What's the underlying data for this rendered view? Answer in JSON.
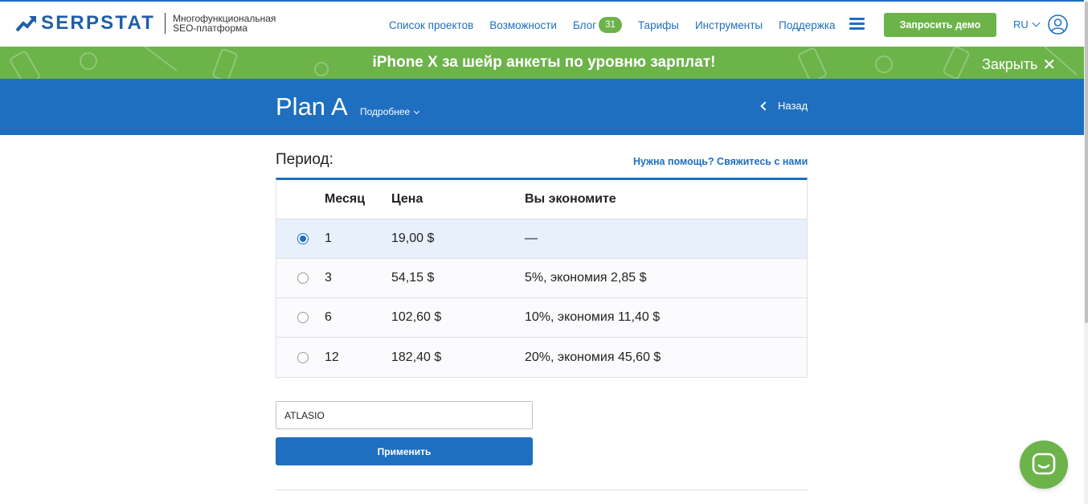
{
  "header": {
    "brand": "SERPSTAT",
    "tagline": "Многофункциональная SEO-платформа",
    "nav": [
      {
        "label": "Список проектов"
      },
      {
        "label": "Возможности"
      },
      {
        "label": "Блог",
        "badge": "31"
      },
      {
        "label": "Тарифы"
      },
      {
        "label": "Инструменты"
      },
      {
        "label": "Поддержка"
      }
    ],
    "demo_button": "Запросить демо",
    "language": "RU",
    "icons": {
      "menu": "hamburger-menu-icon",
      "user": "user-icon",
      "logo": "serpstat-logo-icon"
    }
  },
  "promo": {
    "text": "iPhone X за шейр анкеты по уровню зарплат!",
    "close_label": "Закрыть",
    "close_icon": "✕"
  },
  "plan": {
    "title": "Plan A",
    "details_label": "Подробнее",
    "back_label": "Назад"
  },
  "period": {
    "label": "Период:",
    "help_link": "Нужна помощь? Свяжитесь с нами",
    "columns": [
      "Месяц",
      "Цена",
      "Вы экономите"
    ],
    "rows": [
      {
        "months": "1",
        "price": "19,00 $",
        "savings": "—",
        "selected": true
      },
      {
        "months": "3",
        "price": "54,15 $",
        "savings": "5%, экономия 2,85 $",
        "selected": false
      },
      {
        "months": "6",
        "price": "102,60 $",
        "savings": "10%, экономия 11,40 $",
        "selected": false
      },
      {
        "months": "12",
        "price": "182,40 $",
        "savings": "20%, экономия 45,60 $",
        "selected": false
      }
    ]
  },
  "coupon": {
    "value": "ATLASIO",
    "apply_button": "Применить"
  },
  "colors": {
    "brand_blue": "#1e6fc0",
    "accent_green": "#6cb34a"
  }
}
